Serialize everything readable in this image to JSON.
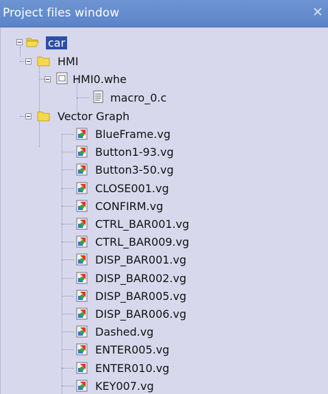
{
  "window": {
    "title": "Project files window",
    "close_glyph": "✕"
  },
  "tree": {
    "root": {
      "label": "car",
      "icon": "open-folder-icon",
      "selected": true
    },
    "hmi": {
      "label": "HMI",
      "icon": "folder-icon"
    },
    "hmi_file": {
      "label": "HMI0.whe",
      "icon": "hmi-file-icon"
    },
    "macro": {
      "label": "macro_0.c",
      "icon": "source-file-icon"
    },
    "vector": {
      "label": "Vector Graph",
      "icon": "folder-icon"
    },
    "vg_files": [
      "BlueFrame.vg",
      "Button1-93.vg",
      "Button3-50.vg",
      "CLOSE001.vg",
      "CONFIRM.vg",
      "CTRL_BAR001.vg",
      "CTRL_BAR009.vg",
      "DISP_BAR001.vg",
      "DISP_BAR002.vg",
      "DISP_BAR005.vg",
      "DISP_BAR006.vg",
      "Dashed.vg",
      "ENTER005.vg",
      "ENTER010.vg",
      "KEY007.vg"
    ]
  },
  "colors": {
    "title_bar": "#5b84c8",
    "background": "#d8d8ed",
    "selection": "#2b4fa9"
  }
}
